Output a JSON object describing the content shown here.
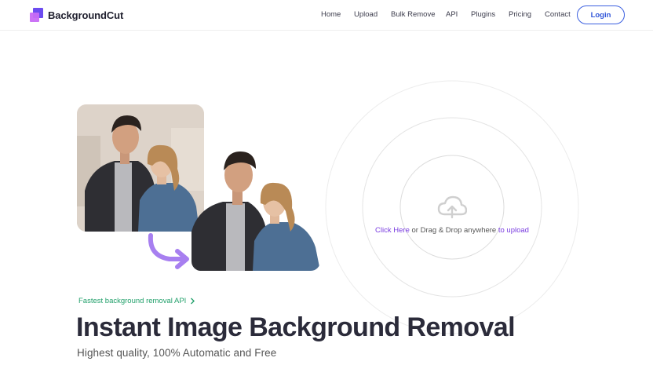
{
  "header": {
    "brand": "BackgroundCut",
    "nav": [
      "Home",
      "Upload",
      "Bulk Remove",
      "API",
      "Plugins",
      "Pricing",
      "Contact"
    ],
    "login_label": "Login"
  },
  "upload": {
    "click_here": "Click Here",
    "middle_text": " or Drag & Drop anywhere ",
    "to_upload": "to upload"
  },
  "hero": {
    "tagline": "Fastest background removal API",
    "title": "Instant Image Background Removal",
    "subtitle": "Highest quality, 100% Automatic and Free"
  },
  "icons": {
    "logo": "backgroundcut-logo-icon",
    "arrow": "curved-arrow-icon",
    "upload": "cloud-upload-icon",
    "chevron": "chevron-right-icon"
  },
  "colors": {
    "accent": "#7a3de0",
    "brand_blue": "#2f54d8",
    "tagline_green": "#22a06b",
    "arrow_purple": "#a77ff0"
  }
}
